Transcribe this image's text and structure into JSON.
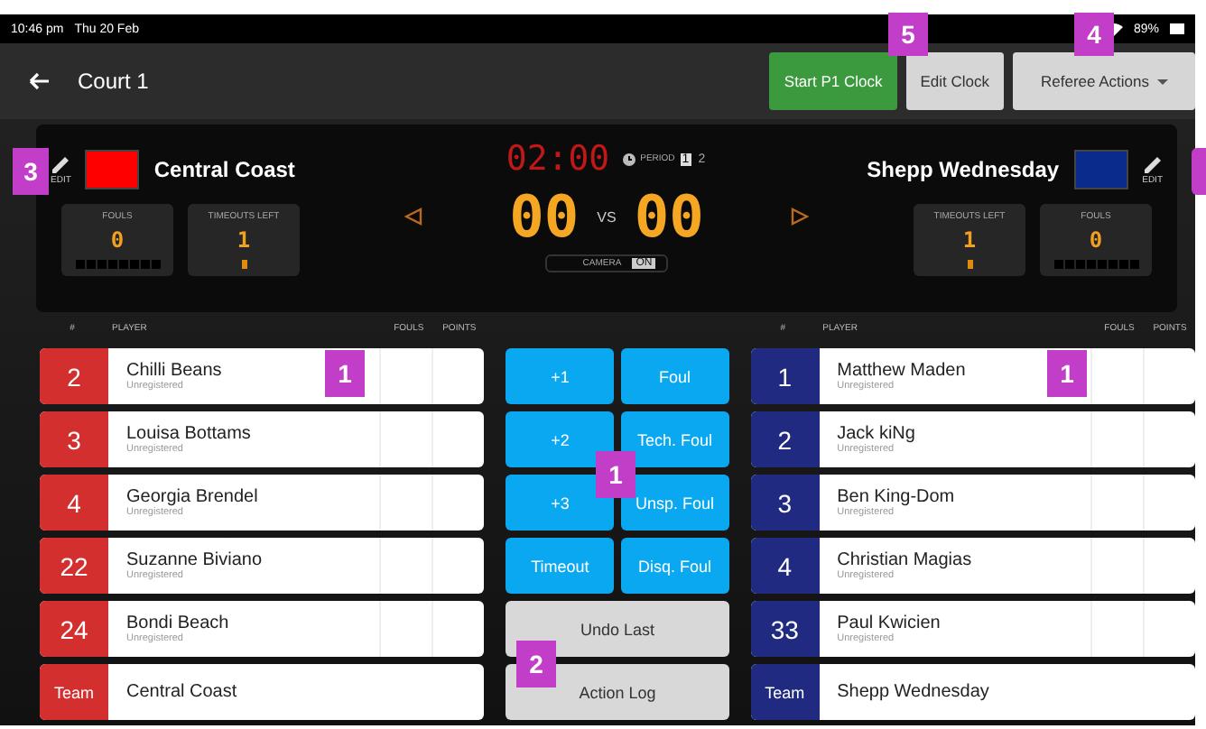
{
  "status_bar": {
    "time": "10:46 pm",
    "date": "Thu 20 Feb",
    "battery": "89%"
  },
  "header": {
    "title": "Court 1",
    "buttons": [
      {
        "label": "Start P1 Clock",
        "kind": "primary"
      },
      {
        "label": "Edit Clock",
        "kind": "secondary"
      },
      {
        "label": "Referee Actions",
        "kind": "dropdown"
      }
    ]
  },
  "scoreboard": {
    "clock": "02:00",
    "period_label": "PERIOD",
    "periods": [
      {
        "label": "1",
        "selected": true
      },
      {
        "label": "2",
        "selected": false
      }
    ],
    "vs": "VS",
    "camera": {
      "label": "CAMERA",
      "toggle": "ON",
      "on": true
    },
    "teams": [
      {
        "name": "Central Coast",
        "color": "#ff0000",
        "edit": "EDIT",
        "score": "00",
        "fouls": {
          "label": "FOULS",
          "value": "0",
          "pips": [
            false,
            false,
            false,
            false,
            false,
            false,
            false,
            false
          ]
        },
        "timeouts": {
          "label": "TIMEOUTS LEFT",
          "value": "1",
          "pips": [
            true
          ]
        }
      },
      {
        "name": "Shepp Wednesday",
        "color": "#0a2a8c",
        "edit": "EDIT",
        "score": "00",
        "fouls": {
          "label": "FOULS",
          "value": "0",
          "pips": [
            false,
            false,
            false,
            false,
            false,
            false,
            false,
            false
          ]
        },
        "timeouts": {
          "label": "TIMEOUTS LEFT",
          "value": "1",
          "pips": [
            true
          ]
        }
      }
    ]
  },
  "rosters": [
    {
      "columns": [
        "#",
        "PLAYER",
        "FOULS",
        "POINTS"
      ],
      "color": "#d32f2f",
      "rows": [
        {
          "number": "2",
          "name": "Chilli Beans",
          "status": "Unregistered"
        },
        {
          "number": "3",
          "name": "Louisa Bottams",
          "status": "Unregistered"
        },
        {
          "number": "4",
          "name": "Georgia Brendel",
          "status": "Unregistered"
        },
        {
          "number": "22",
          "name": "Suzanne Biviano",
          "status": "Unregistered"
        },
        {
          "number": "24",
          "name": "Bondi Beach",
          "status": "Unregistered"
        },
        {
          "number": "Team",
          "name": "Central Coast",
          "kind": "team"
        }
      ]
    },
    {
      "columns": [
        "#",
        "PLAYER",
        "FOULS",
        "POINTS"
      ],
      "color": "#1f2a80",
      "rows": [
        {
          "number": "1",
          "name": "Matthew Maden",
          "status": "Unregistered"
        },
        {
          "number": "2",
          "name": "Jack kiNg",
          "status": "Unregistered"
        },
        {
          "number": "3",
          "name": "Ben King-Dom",
          "status": "Unregistered"
        },
        {
          "number": "4",
          "name": "Christian Magias",
          "status": "Unregistered"
        },
        {
          "number": "33",
          "name": "Paul Kwicien",
          "status": "Unregistered"
        },
        {
          "number": "Team",
          "name": "Shepp Wednesday",
          "kind": "team"
        }
      ]
    }
  ],
  "actions": {
    "scoring": [
      "+1",
      "Foul",
      "+2",
      "Tech. Foul",
      "+3",
      "Unsp. Foul",
      "Timeout",
      "Disq. Foul"
    ],
    "other": [
      "Undo Last",
      "Action Log"
    ]
  },
  "callouts": [
    {
      "label": "5"
    },
    {
      "label": "4"
    },
    {
      "label": "3"
    },
    {
      "kind": "clipped"
    },
    {
      "label": "1"
    },
    {
      "label": "1"
    },
    {
      "label": "1"
    },
    {
      "label": "2"
    }
  ]
}
